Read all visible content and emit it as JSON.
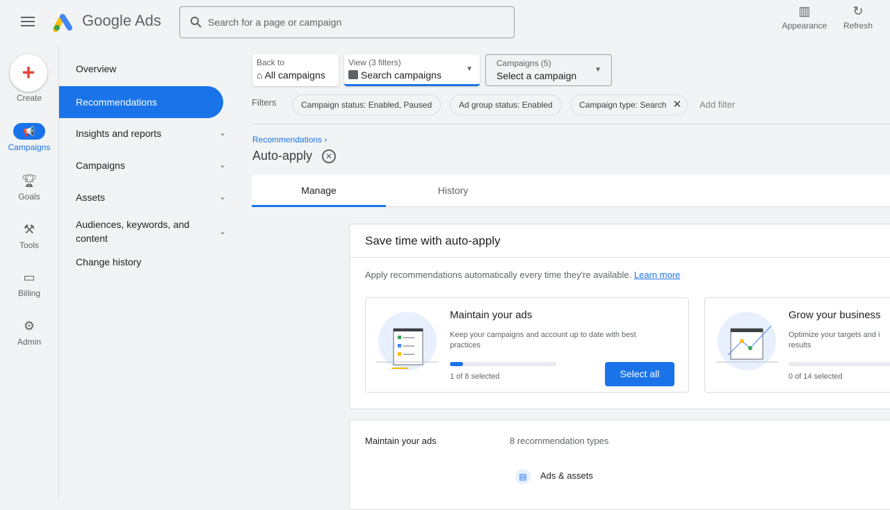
{
  "header": {
    "app_name": "Google Ads",
    "search_placeholder": "Search for a page or campaign",
    "appearance": "Appearance",
    "refresh": "Refresh"
  },
  "rail": {
    "create": "Create",
    "campaigns": "Campaigns",
    "goals": "Goals",
    "tools": "Tools",
    "billing": "Billing",
    "admin": "Admin"
  },
  "sidebar": {
    "items": [
      {
        "label": "Overview"
      },
      {
        "label": "Recommendations"
      },
      {
        "label": "Insights and reports"
      },
      {
        "label": "Campaigns"
      },
      {
        "label": "Assets"
      },
      {
        "label": "Audiences, keywords, and content"
      },
      {
        "label": "Change history"
      }
    ]
  },
  "selectors": {
    "back_label": "Back to",
    "back_value": "All campaigns",
    "view_label": "View (3 filters)",
    "view_value": "Search campaigns",
    "campaigns_label": "Campaigns (5)",
    "campaigns_value": "Select a campaign"
  },
  "filters": {
    "label": "Filters",
    "chips": [
      "Campaign status: Enabled, Paused",
      "Ad group status: Enabled",
      "Campaign type: Search"
    ],
    "add": "Add filter"
  },
  "breadcrumb": "Recommendations",
  "title": "Auto-apply",
  "tabs": [
    "Manage",
    "History"
  ],
  "autoapply": {
    "title": "Save time with auto-apply",
    "desc": "Apply recommendations automatically every time they're available.",
    "learn": "Learn more",
    "cards": [
      {
        "title": "Maintain your ads",
        "desc": "Keep your campaigns and account up to date with best practices",
        "selected": "1 of 8 selected",
        "progress": 0.125,
        "button": "Select all"
      },
      {
        "title": "Grow your business",
        "desc": "Optimize your targets and i results",
        "selected": "0 of 14 selected",
        "progress": 0
      }
    ]
  },
  "list": {
    "section": "Maintain your ads",
    "count": "8 recommendation types",
    "item": "Ads & assets"
  }
}
